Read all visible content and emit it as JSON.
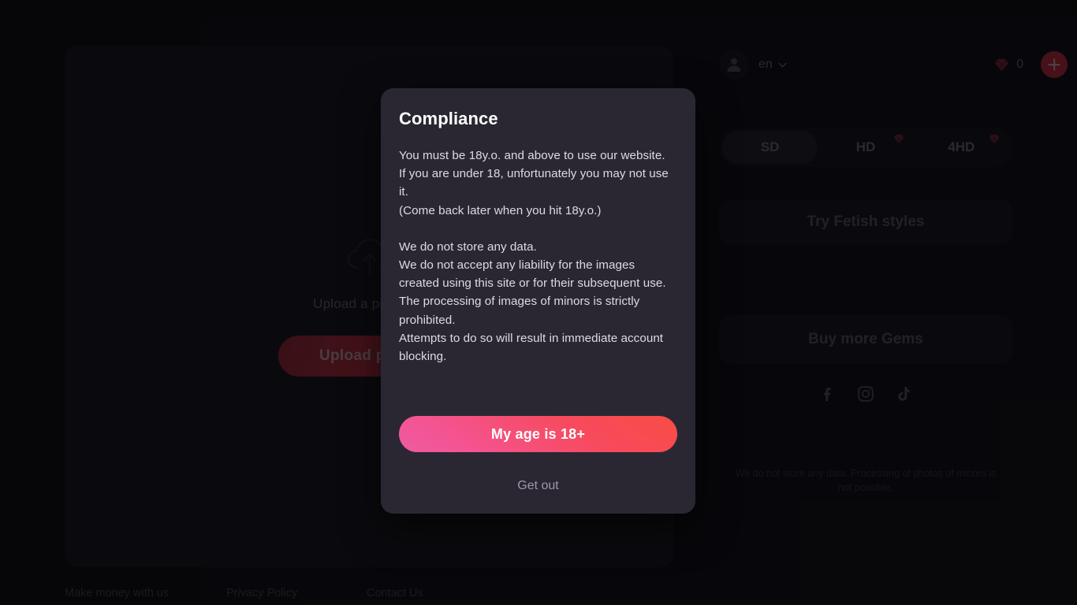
{
  "background": {
    "upload": {
      "icon": "cloud-upload-icon",
      "hint": "Upload a picture...",
      "button_label": "Upload photo"
    },
    "header": {
      "avatar_icon": "user-avatar-icon",
      "language": "en",
      "language_chevron_icon": "chevron-down-icon",
      "gem_icon": "gem-icon",
      "gem_count": "0",
      "add_icon": "plus-icon"
    },
    "quality": {
      "options": [
        {
          "label": "SD",
          "selected": true,
          "badge": false
        },
        {
          "label": "HD",
          "selected": false,
          "badge": true
        },
        {
          "label": "4HD",
          "selected": false,
          "badge": true
        }
      ]
    },
    "actions": {
      "fetish_label": "Try Fetish styles",
      "gems_label": "Buy more Gems"
    },
    "socials": [
      {
        "name": "facebook-icon"
      },
      {
        "name": "instagram-icon"
      },
      {
        "name": "tiktok-icon"
      }
    ],
    "rail_note": "We do not store any data. Processing of photos of minors is not possible.",
    "footer": [
      "Make money with us",
      "Privacy Policy",
      "Contact Us"
    ]
  },
  "modal": {
    "title": "Compliance",
    "paragraph1": "You must be 18y.o. and above to use our website.\nIf you are under 18, unfortunately you may not use it.\n(Come back later when you hit 18y.o.)",
    "paragraph2": "We do not store any data.\nWe do not accept any liability for the images created using this site or for their subsequent use.\nThe processing of images of minors is strictly prohibited.\nAttempts to do so will result in immediate account blocking.",
    "confirm_label": "My age is 18+",
    "decline_label": "Get out"
  },
  "colors": {
    "page_bg": "#09090d",
    "modal_bg": "#2a2733",
    "accent_pink": "#ef5ba2",
    "accent_red": "#f94c45",
    "gem_red": "#7a2030"
  }
}
